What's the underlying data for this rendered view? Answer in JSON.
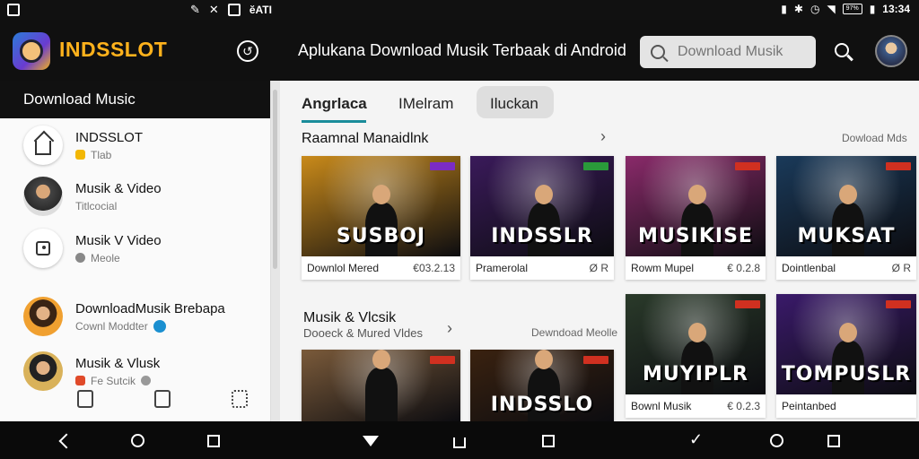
{
  "status_bar": {
    "left_text": "ĕATI",
    "time": "13:34",
    "battery": "97%"
  },
  "app_bar": {
    "brand": "INDSSLOT",
    "title": "Aplukana Download Musik Terbaak di Android",
    "search_placeholder": "Download Musik"
  },
  "sidebar": {
    "header": "Download Music",
    "items": [
      {
        "title": "INDSSLOT",
        "subtitle": "Tlab",
        "sub_color": "#f2b705"
      },
      {
        "title": "Musik & Video",
        "subtitle": "Titlcocial",
        "sub_color": ""
      },
      {
        "title": "Musik V Video",
        "subtitle": "Meole",
        "sub_color": "#888888"
      },
      {
        "title": "DownloadMusik Brebapa",
        "subtitle": "Cownl Moddter",
        "sub_color": "#1a8fd0"
      },
      {
        "title": "Musik & Vlusk",
        "subtitle": "Fe Sutcik",
        "sub_color": "#e04a2a"
      }
    ]
  },
  "tabs": [
    {
      "label": "Angrlaca"
    },
    {
      "label": "IMelram"
    },
    {
      "label": "Iluckan"
    }
  ],
  "section1": {
    "title": "Raamnal Manaidlnk",
    "see_all": "Dowload Mds"
  },
  "section2": {
    "title": "Musik & Vlcsik",
    "subtitle": "Dooeck & Mured Vldes",
    "see_all": "Dewndoad Meolle"
  },
  "cards": [
    {
      "title": "Downlol Mered",
      "duration": "€03.2.13",
      "overlay": "SUSBOJ",
      "badge_color": "#7b2cc4",
      "bg": "#c98a1a"
    },
    {
      "title": "Pramerolal",
      "duration": "Ø R",
      "overlay": "INDSSLR",
      "badge_color": "#2a9a3a",
      "bg": "#3a1a5a"
    },
    {
      "title": "Rowm Mupel",
      "duration": "€ 0.2.8",
      "overlay": "MUSIKISE",
      "badge_color": "#d03020",
      "bg": "#8a2a6a"
    },
    {
      "title": "Dointlenbal",
      "duration": "Ø R",
      "overlay": "MUKSAT",
      "badge_color": "#d03020",
      "bg": "#1a3a5a"
    },
    {
      "title": "Bownl Musik",
      "duration": "€ 0.2.3",
      "overlay": "MUYIPLR",
      "badge_color": "#d03020",
      "bg": "#2a3a2a"
    },
    {
      "title": "Peintanbed",
      "duration": "",
      "overlay": "TOMPUSLR",
      "badge_color": "#d03020",
      "bg": "#3a1a6a"
    },
    {
      "title": "",
      "duration": "",
      "overlay": "",
      "badge_color": "#d03020",
      "bg": "#7a5a3a"
    },
    {
      "title": "",
      "duration": "",
      "overlay": "INDSSLO",
      "badge_color": "#d03020",
      "bg": "#3a2210"
    }
  ]
}
